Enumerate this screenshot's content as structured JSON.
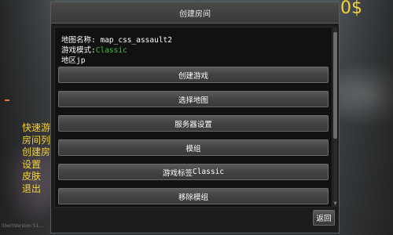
{
  "hud": {
    "money": "0$",
    "version": "libertVersion:51..."
  },
  "side_menu": {
    "items": [
      "快速游",
      "房间列",
      "创建房",
      "设置",
      "皮肤",
      "退出"
    ]
  },
  "dialog": {
    "title": "创建房间",
    "info": {
      "map_label": "地图名称",
      "map_sep": ": ",
      "map_value": "map_css_assault2",
      "mode_label": "游戏模式",
      "mode_sep": ":",
      "mode_value": "Classic",
      "region_label": "地区",
      "region_value": "jp"
    },
    "buttons": [
      {
        "label": "创建游戏"
      },
      {
        "label": "选择地图"
      },
      {
        "label": "服务器设置"
      },
      {
        "label": "模组"
      },
      {
        "label_cn": "游戏标签",
        "label_en": "Classic"
      },
      {
        "label": "移除模组"
      }
    ],
    "back_label": "返回"
  },
  "colors": {
    "money": "#f4d23c",
    "side_menu": "#f4d23c",
    "mode_value": "#3ec23e",
    "dialog_bg": "#1c1c1c",
    "button_bg": "#4a4a4a"
  }
}
